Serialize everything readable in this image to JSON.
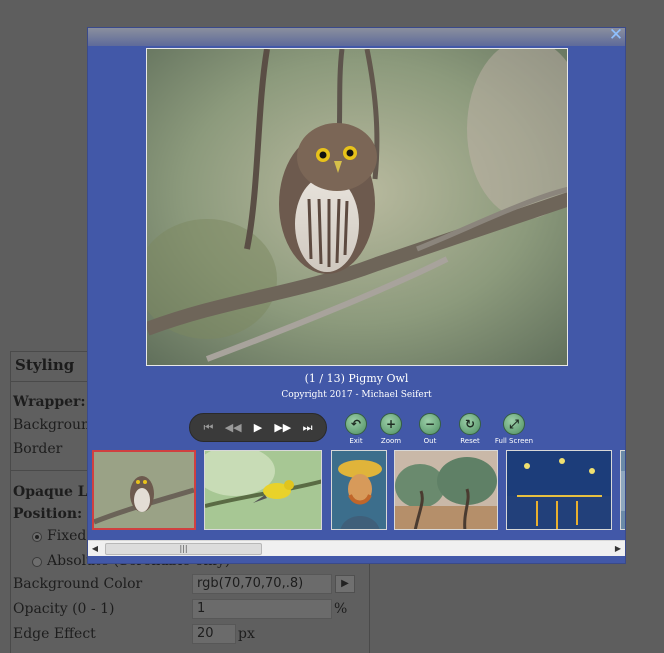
{
  "styling_panel": {
    "title": "Styling",
    "wrapper_heading": "Wrapper:",
    "background_label": "Background",
    "border_label": "Border",
    "opaque_layer_heading": "Opaque Lay",
    "position_label": "Position:",
    "fixed_label": "Fixed (",
    "absolute_label": "Absolute (Scrollable only)",
    "background_color_label": "Background Color",
    "background_color_value": "rgb(70,70,70,.8)",
    "opacity_label": "Opacity (0 - 1)",
    "opacity_value": "1",
    "opacity_unit": "%",
    "edge_effect_label": "Edge Effect",
    "edge_effect_value": "20",
    "edge_effect_unit": "px",
    "picker_glyph": "▶"
  },
  "lightbox": {
    "close_glyph": "✕",
    "caption_title": "(1 / 13)  Pigmy Owl",
    "caption_credit": "Copyright 2017 - Michael Seifert",
    "controls": [
      {
        "name": "first-icon",
        "glyph": "⏮"
      },
      {
        "name": "rewind-icon",
        "glyph": "◀◀"
      },
      {
        "name": "play-icon",
        "glyph": "▶"
      },
      {
        "name": "fast-forward-icon",
        "glyph": "▶▶"
      },
      {
        "name": "last-icon",
        "glyph": "⏭"
      }
    ],
    "tools": [
      {
        "name": "exit",
        "label": "Exit",
        "glyph": "↶"
      },
      {
        "name": "zoom",
        "label": "Zoom",
        "glyph": "+"
      },
      {
        "name": "out",
        "label": "Out",
        "glyph": "−"
      },
      {
        "name": "reset",
        "label": "Reset",
        "glyph": "↻"
      },
      {
        "name": "full-screen",
        "label": "Full Screen",
        "glyph": "⤢"
      }
    ],
    "thumbnails": [
      "pigmy-owl",
      "yellow-warbler",
      "van-gogh-self-portrait",
      "olive-trees",
      "starry-night-over-rhone",
      "next-partial"
    ],
    "scroll": {
      "left": "◀",
      "right": "▶",
      "grip": "|||"
    }
  },
  "colors": {
    "lightbox_bg": "#4258a8",
    "page_dim": "#5e5e5e",
    "selected_thumb_border": "#d04040",
    "tool_icon": "#4e8f62"
  }
}
